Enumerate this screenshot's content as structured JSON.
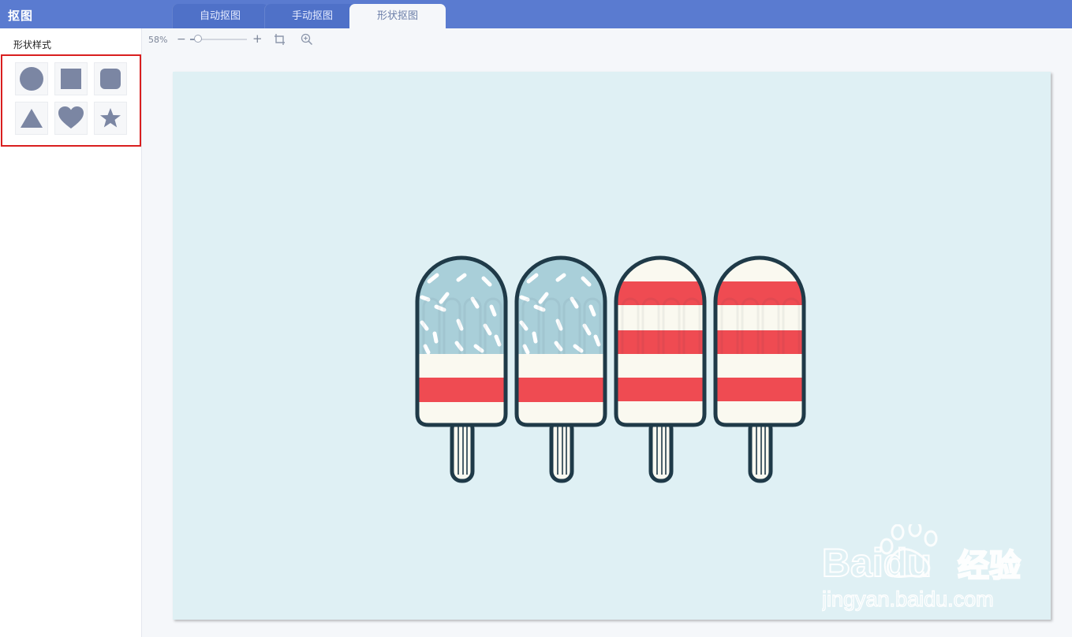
{
  "app": {
    "title": "抠图"
  },
  "tabs": [
    {
      "label": "自动抠图",
      "active": false
    },
    {
      "label": "手动抠图",
      "active": false
    },
    {
      "label": "形状抠图",
      "active": true
    }
  ],
  "sidebar": {
    "title": "形状样式",
    "shapes": [
      {
        "name": "circle",
        "icon": "circle-icon"
      },
      {
        "name": "square",
        "icon": "square-icon"
      },
      {
        "name": "rounded-square",
        "icon": "rounded-square-icon"
      },
      {
        "name": "triangle",
        "icon": "triangle-icon"
      },
      {
        "name": "heart",
        "icon": "heart-icon"
      },
      {
        "name": "star",
        "icon": "star-icon"
      }
    ],
    "highlight_color": "#d91f1f",
    "shape_color": "#7b86a3"
  },
  "toolbar": {
    "zoom_label": "58%",
    "zoom_fraction": 0.14,
    "icons": [
      "zoom-out-icon",
      "zoom-in-icon",
      "crop-fit-icon",
      "magnifier-icon"
    ]
  },
  "canvas": {
    "background": "#dff0f4",
    "content": "four-popsicles-illustration",
    "colors": {
      "outline": "#1f3a48",
      "red": "#ef4b52",
      "cream": "#faf9f0",
      "blue": "#a9cfd9"
    }
  },
  "watermark": {
    "brand": "Baidu",
    "brand_suffix": "经验",
    "url": "jingyan.baidu.com"
  },
  "accent": "#5a7bd0"
}
